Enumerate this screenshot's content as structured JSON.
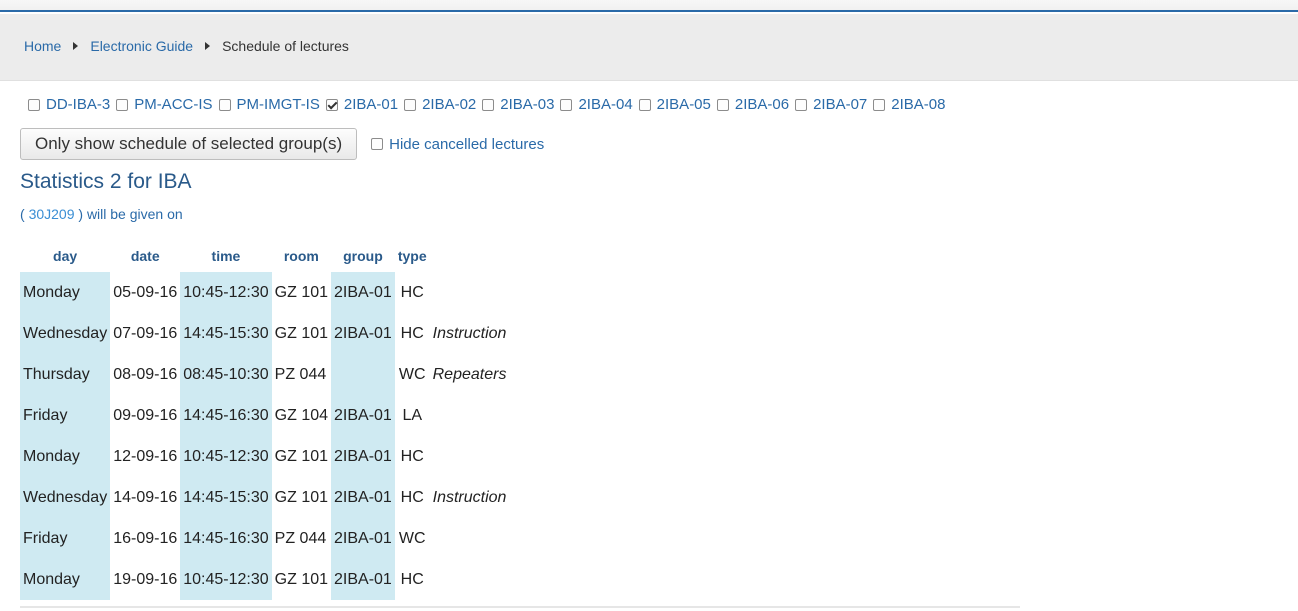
{
  "breadcrumb": {
    "home": "Home",
    "guide": "Electronic Guide",
    "current": "Schedule of lectures"
  },
  "groups": [
    {
      "label": "DD-IBA-3",
      "checked": false
    },
    {
      "label": "PM-ACC-IS",
      "checked": false
    },
    {
      "label": "PM-IMGT-IS",
      "checked": false
    },
    {
      "label": "2IBA-01",
      "checked": true
    },
    {
      "label": "2IBA-02",
      "checked": false
    },
    {
      "label": "2IBA-03",
      "checked": false
    },
    {
      "label": "2IBA-04",
      "checked": false
    },
    {
      "label": "2IBA-05",
      "checked": false
    },
    {
      "label": "2IBA-06",
      "checked": false
    },
    {
      "label": "2IBA-07",
      "checked": false
    },
    {
      "label": "2IBA-08",
      "checked": false
    }
  ],
  "actions": {
    "filter_button": "Only show schedule of selected group(s)",
    "hide_cancelled_label": "Hide cancelled lectures",
    "hide_cancelled_checked": false
  },
  "course": {
    "title": "Statistics 2 for IBA",
    "open_paren": "(",
    "code": "30J209",
    "suffix": ") will be given on"
  },
  "table": {
    "columns": [
      "day",
      "date",
      "time",
      "room",
      "group",
      "type"
    ],
    "rows": [
      {
        "day": "Monday",
        "date": "05-09-16",
        "time": "10:45-12:30",
        "room": "GZ 101",
        "group": "2IBA-01",
        "type": "HC",
        "note": ""
      },
      {
        "day": "Wednesday",
        "date": "07-09-16",
        "time": "14:45-15:30",
        "room": "GZ 101",
        "group": "2IBA-01",
        "type": "HC",
        "note": "Instruction"
      },
      {
        "day": "Thursday",
        "date": "08-09-16",
        "time": "08:45-10:30",
        "room": "PZ 044",
        "group": "",
        "type": "WC",
        "note": "Repeaters"
      },
      {
        "day": "Friday",
        "date": "09-09-16",
        "time": "14:45-16:30",
        "room": "GZ 104",
        "group": "2IBA-01",
        "type": "LA",
        "note": ""
      },
      {
        "day": "Monday",
        "date": "12-09-16",
        "time": "10:45-12:30",
        "room": "GZ 101",
        "group": "2IBA-01",
        "type": "HC",
        "note": ""
      },
      {
        "day": "Wednesday",
        "date": "14-09-16",
        "time": "14:45-15:30",
        "room": "GZ 101",
        "group": "2IBA-01",
        "type": "HC",
        "note": "Instruction"
      },
      {
        "day": "Friday",
        "date": "16-09-16",
        "time": "14:45-16:30",
        "room": "PZ 044",
        "group": "2IBA-01",
        "type": "WC",
        "note": ""
      },
      {
        "day": "Monday",
        "date": "19-09-16",
        "time": "10:45-12:30",
        "room": "GZ 101",
        "group": "2IBA-01",
        "type": "HC",
        "note": ""
      }
    ]
  },
  "colors": {
    "link": "#2a6aa8",
    "heading": "#2a5a8a",
    "shade": "#cfeaf2"
  }
}
